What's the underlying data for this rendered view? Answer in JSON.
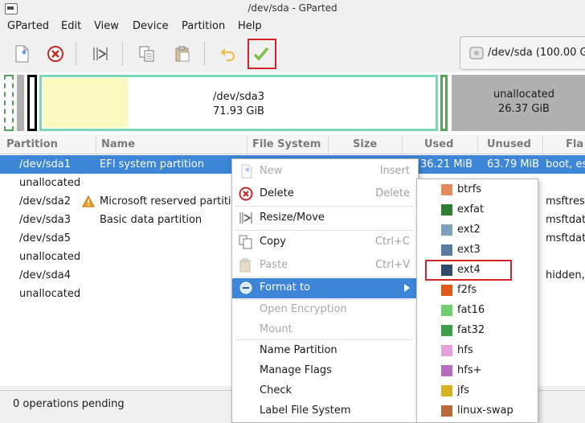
{
  "window": {
    "title": "/dev/sda - GParted"
  },
  "menubar": [
    "GParted",
    "Edit",
    "View",
    "Device",
    "Partition",
    "Help"
  ],
  "device_selector": {
    "label": "/dev/sda (100.00 G"
  },
  "graph": {
    "sda3": {
      "name": "/dev/sda3",
      "size": "71.93 GiB"
    },
    "unalloc": {
      "name": "unallocated",
      "size": "26.37 GiB"
    }
  },
  "columns": [
    "Partition",
    "Name",
    "File System",
    "Size",
    "Used",
    "Unused",
    "Fla"
  ],
  "rows": [
    {
      "partition": "/dev/sda1",
      "name": "EFI system partition",
      "used": "36.21 MiB",
      "unused": "63.79 MiB",
      "flags": "boot, es"
    },
    {
      "partition": "unallocated",
      "name": "",
      "used": "",
      "unused": "",
      "flags": ""
    },
    {
      "partition": "/dev/sda2",
      "name": "Microsoft reserved partiti",
      "used": "",
      "unused": "",
      "flags": "msftres"
    },
    {
      "partition": "/dev/sda3",
      "name": "Basic data partition",
      "used": "",
      "unused": "",
      "flags": "msftdat"
    },
    {
      "partition": "/dev/sda5",
      "name": "",
      "used": "",
      "unused": "",
      "flags": "msftdat"
    },
    {
      "partition": "unallocated",
      "name": "",
      "used": "",
      "unused": "",
      "flags": ""
    },
    {
      "partition": "/dev/sda4",
      "name": "",
      "used": "",
      "unused": "",
      "flags": "hidden,"
    },
    {
      "partition": "unallocated",
      "name": "",
      "used": "",
      "unused": "",
      "flags": ""
    }
  ],
  "status": "0 operations pending",
  "context_menu": [
    {
      "label": "New",
      "accel": "Insert",
      "disabled": true,
      "icon": "new-icon"
    },
    {
      "label": "Delete",
      "accel": "Delete",
      "disabled": false,
      "icon": "delete-icon"
    },
    {
      "label": "Resize/Move",
      "accel": "",
      "disabled": false,
      "icon": "resize-icon"
    },
    {
      "label": "Copy",
      "accel": "Ctrl+C",
      "disabled": false,
      "icon": "copy-icon"
    },
    {
      "label": "Paste",
      "accel": "Ctrl+V",
      "disabled": true,
      "icon": "paste-icon"
    },
    {
      "label": "Format to",
      "accel": "",
      "disabled": false,
      "icon": "format-icon",
      "highlighted": true
    },
    {
      "label": "Open Encryption",
      "accel": "",
      "disabled": true
    },
    {
      "label": "Mount",
      "accel": "",
      "disabled": true
    },
    {
      "label": "Name Partition",
      "accel": "",
      "disabled": false
    },
    {
      "label": "Manage Flags",
      "accel": "",
      "disabled": false
    },
    {
      "label": "Check",
      "accel": "",
      "disabled": false
    },
    {
      "label": "Label File System",
      "accel": "",
      "disabled": false
    }
  ],
  "filesystems": [
    {
      "name": "btrfs",
      "color": "#e58a5a"
    },
    {
      "name": "exfat",
      "color": "#2e7d32"
    },
    {
      "name": "ext2",
      "color": "#7f9fbf"
    },
    {
      "name": "ext3",
      "color": "#5a7aa0"
    },
    {
      "name": "ext4",
      "color": "#2f4a6e"
    },
    {
      "name": "f2fs",
      "color": "#e05a1a"
    },
    {
      "name": "fat16",
      "color": "#6fcf6f"
    },
    {
      "name": "fat32",
      "color": "#3aa04a"
    },
    {
      "name": "hfs",
      "color": "#e3a0dc"
    },
    {
      "name": "hfs+",
      "color": "#b86cc0"
    },
    {
      "name": "jfs",
      "color": "#d6b21e"
    },
    {
      "name": "linux-swap",
      "color": "#b86a3a"
    }
  ]
}
